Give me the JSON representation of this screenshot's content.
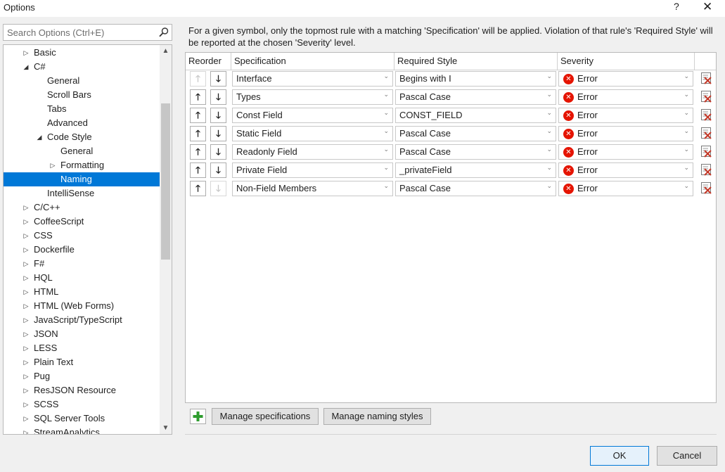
{
  "window": {
    "title": "Options",
    "help_glyph": "?",
    "close_glyph": "✕"
  },
  "search": {
    "placeholder": "Search Options (Ctrl+E)"
  },
  "tree": [
    {
      "label": "Basic",
      "level": 1,
      "expander": "collapsed",
      "name": "tree-item-basic"
    },
    {
      "label": "C#",
      "level": 1,
      "expander": "expanded",
      "name": "tree-item-csharp"
    },
    {
      "label": "General",
      "level": 2,
      "expander": "none",
      "name": "tree-item-csharp-general"
    },
    {
      "label": "Scroll Bars",
      "level": 2,
      "expander": "none",
      "name": "tree-item-scroll-bars"
    },
    {
      "label": "Tabs",
      "level": 2,
      "expander": "none",
      "name": "tree-item-tabs"
    },
    {
      "label": "Advanced",
      "level": 2,
      "expander": "none",
      "name": "tree-item-advanced"
    },
    {
      "label": "Code Style",
      "level": 2,
      "expander": "expanded",
      "name": "tree-item-code-style"
    },
    {
      "label": "General",
      "level": 3,
      "expander": "none",
      "name": "tree-item-code-style-general"
    },
    {
      "label": "Formatting",
      "level": 3,
      "expander": "collapsed",
      "name": "tree-item-formatting"
    },
    {
      "label": "Naming",
      "level": 3,
      "expander": "none",
      "selected": true,
      "name": "tree-item-naming"
    },
    {
      "label": "IntelliSense",
      "level": 2,
      "expander": "none",
      "name": "tree-item-intellisense"
    },
    {
      "label": "C/C++",
      "level": 1,
      "expander": "collapsed",
      "name": "tree-item-cpp"
    },
    {
      "label": "CoffeeScript",
      "level": 1,
      "expander": "collapsed",
      "name": "tree-item-coffeescript"
    },
    {
      "label": "CSS",
      "level": 1,
      "expander": "collapsed",
      "name": "tree-item-css"
    },
    {
      "label": "Dockerfile",
      "level": 1,
      "expander": "collapsed",
      "name": "tree-item-dockerfile"
    },
    {
      "label": "F#",
      "level": 1,
      "expander": "collapsed",
      "name": "tree-item-fsharp"
    },
    {
      "label": "HQL",
      "level": 1,
      "expander": "collapsed",
      "name": "tree-item-hql"
    },
    {
      "label": "HTML",
      "level": 1,
      "expander": "collapsed",
      "name": "tree-item-html"
    },
    {
      "label": "HTML (Web Forms)",
      "level": 1,
      "expander": "collapsed",
      "name": "tree-item-html-web-forms"
    },
    {
      "label": "JavaScript/TypeScript",
      "level": 1,
      "expander": "collapsed",
      "name": "tree-item-javascript-typescript"
    },
    {
      "label": "JSON",
      "level": 1,
      "expander": "collapsed",
      "name": "tree-item-json"
    },
    {
      "label": "LESS",
      "level": 1,
      "expander": "collapsed",
      "name": "tree-item-less"
    },
    {
      "label": "Plain Text",
      "level": 1,
      "expander": "collapsed",
      "name": "tree-item-plain-text"
    },
    {
      "label": "Pug",
      "level": 1,
      "expander": "collapsed",
      "name": "tree-item-pug"
    },
    {
      "label": "ResJSON Resource",
      "level": 1,
      "expander": "collapsed",
      "name": "tree-item-resjson-resource"
    },
    {
      "label": "SCSS",
      "level": 1,
      "expander": "collapsed",
      "name": "tree-item-scss"
    },
    {
      "label": "SQL Server Tools",
      "level": 1,
      "expander": "collapsed",
      "name": "tree-item-sql-server-tools"
    },
    {
      "label": "StreamAnalytics",
      "level": 1,
      "expander": "collapsed",
      "name": "tree-item-streamanalytics"
    }
  ],
  "description": "For a given symbol, only the topmost rule with a matching 'Specification' will be applied. Violation of that rule's 'Required Style' will be reported at the chosen 'Severity' level.",
  "columns": {
    "reorder": "Reorder",
    "specification": "Specification",
    "required_style": "Required Style",
    "severity": "Severity"
  },
  "rules": [
    {
      "specification": "Interface",
      "style": "Begins with I",
      "severity": "Error",
      "up_enabled": false,
      "down_enabled": true
    },
    {
      "specification": "Types",
      "style": "Pascal Case",
      "severity": "Error",
      "up_enabled": true,
      "down_enabled": true
    },
    {
      "specification": "Const Field",
      "style": "CONST_FIELD",
      "severity": "Error",
      "up_enabled": true,
      "down_enabled": true
    },
    {
      "specification": "Static Field",
      "style": "Pascal Case",
      "severity": "Error",
      "up_enabled": true,
      "down_enabled": true
    },
    {
      "specification": "Readonly Field",
      "style": "Pascal Case",
      "severity": "Error",
      "up_enabled": true,
      "down_enabled": true
    },
    {
      "specification": "Private Field",
      "style": "_privateField",
      "severity": "Error",
      "up_enabled": true,
      "down_enabled": true
    },
    {
      "specification": "Non-Field Members",
      "style": "Pascal Case",
      "severity": "Error",
      "up_enabled": true,
      "down_enabled": false
    }
  ],
  "icons": {
    "arrow_up": "🡑",
    "arrow_down": "🡓",
    "chevron": "⌄",
    "error": "✕",
    "add": "add-icon",
    "delete": "delete-row-icon"
  },
  "buttons": {
    "manage_specifications": "Manage specifications",
    "manage_naming_styles": "Manage naming styles",
    "ok": "OK",
    "cancel": "Cancel"
  },
  "colors": {
    "selection": "#0078d7",
    "error": "#e51400",
    "add": "#2e9c2e",
    "delete": "#c43a2a"
  }
}
